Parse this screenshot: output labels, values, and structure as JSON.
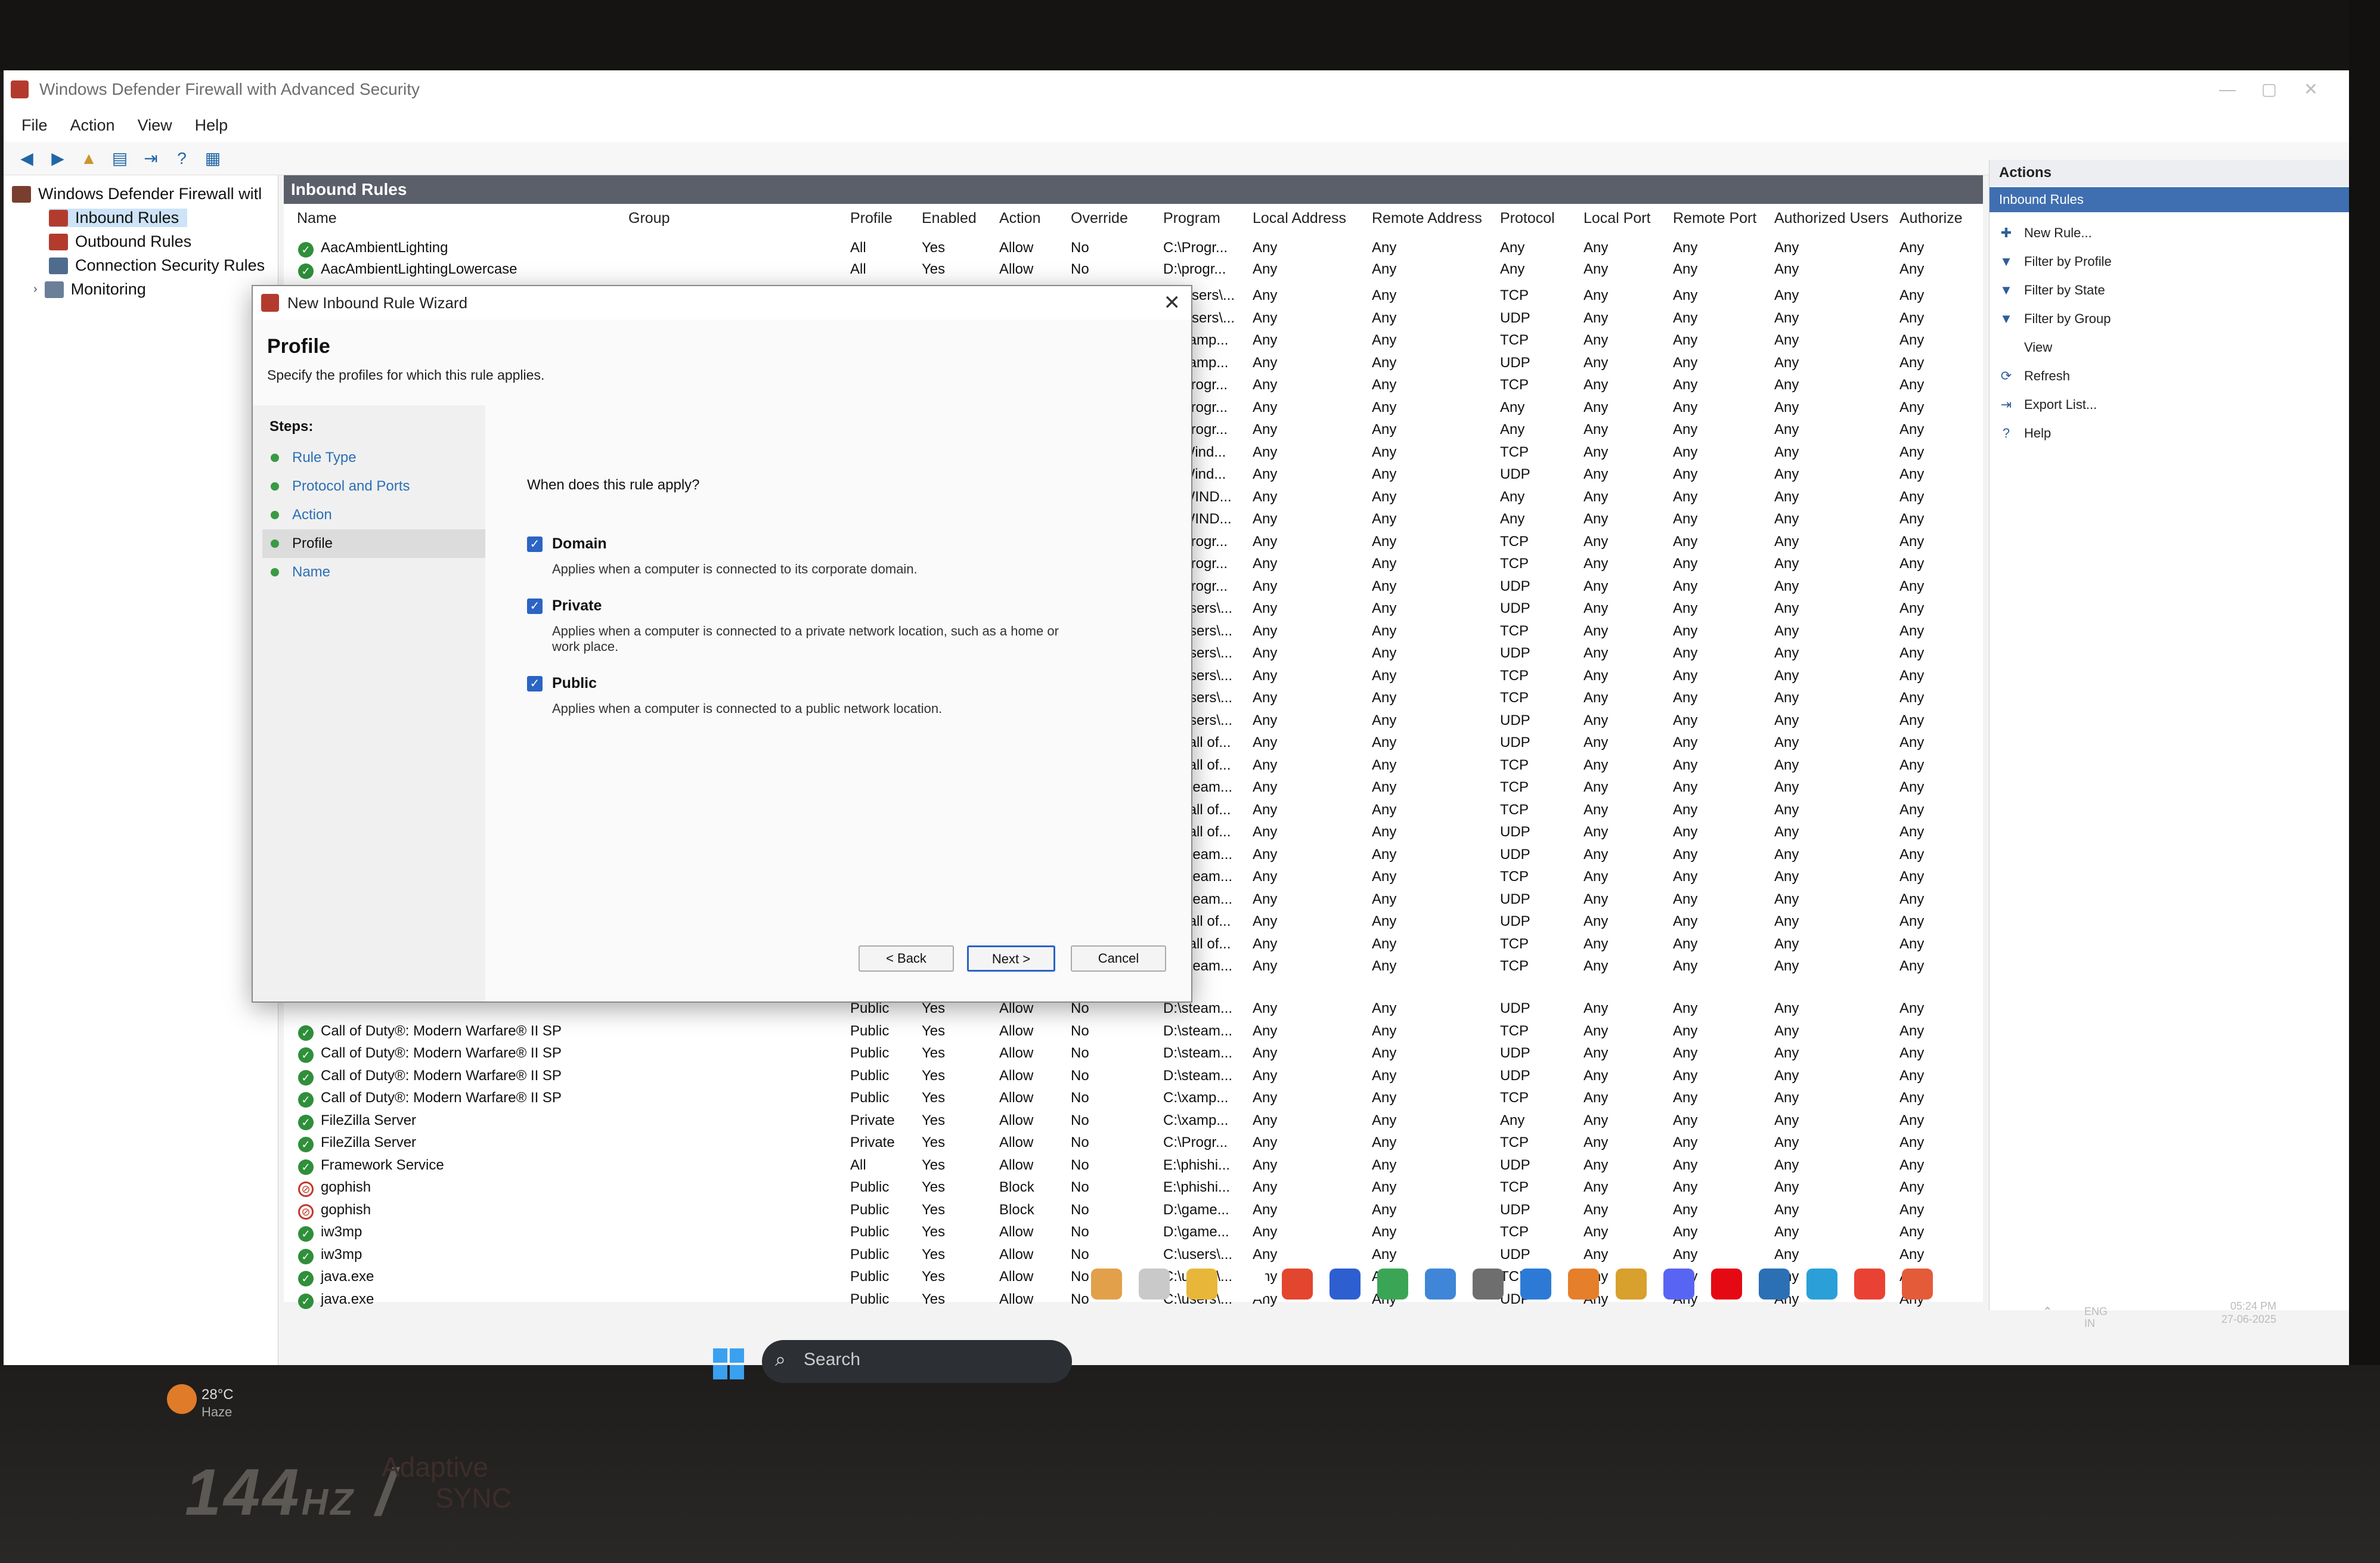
{
  "window": {
    "title": "Windows Defender Firewall with Advanced Security",
    "menu": [
      "File",
      "Action",
      "View",
      "Help"
    ]
  },
  "tree": {
    "root": "Windows Defender Firewall witl",
    "items": [
      "Inbound Rules",
      "Outbound Rules",
      "Connection Security Rules",
      "Monitoring"
    ]
  },
  "list": {
    "header": "Inbound Rules",
    "columns": [
      "Name",
      "Group",
      "Profile",
      "Enabled",
      "Action",
      "Override",
      "Program",
      "Local Address",
      "Remote Address",
      "Protocol",
      "Local Port",
      "Remote Port",
      "Authorized Users",
      "Authorize"
    ],
    "top_rows": [
      {
        "name": "AacAmbientLighting",
        "profile": "All",
        "enabled": "Yes",
        "action": "Allow",
        "override": "No",
        "program": "C:\\Progr...",
        "local": "Any",
        "remote": "Any",
        "protocol": "Any",
        "lport": "Any",
        "rport": "Any",
        "users": "Any",
        "auth": "Any"
      },
      {
        "name": "AacAmbientLightingLowercase",
        "profile": "All",
        "enabled": "Yes",
        "action": "Allow",
        "override": "No",
        "program": "D:\\progr...",
        "local": "Any",
        "remote": "Any",
        "protocol": "Any",
        "lport": "Any",
        "rport": "Any",
        "users": "Any",
        "auth": "Any"
      }
    ],
    "side_rows": [
      {
        "program": "C:\\Users\\...",
        "local": "Any",
        "remote": "Any",
        "protocol": "TCP",
        "lport": "Any",
        "rport": "Any",
        "users": "Any",
        "auth": "Any"
      },
      {
        "program": "C:\\Users\\...",
        "local": "Any",
        "remote": "Any",
        "protocol": "UDP",
        "lport": "Any",
        "rport": "Any",
        "users": "Any",
        "auth": "Any"
      },
      {
        "program": "C:\\xamp...",
        "local": "Any",
        "remote": "Any",
        "protocol": "TCP",
        "lport": "Any",
        "rport": "Any",
        "users": "Any",
        "auth": "Any"
      },
      {
        "program": "C:\\xamp...",
        "local": "Any",
        "remote": "Any",
        "protocol": "UDP",
        "lport": "Any",
        "rport": "Any",
        "users": "Any",
        "auth": "Any"
      },
      {
        "program": "C:\\Progr...",
        "local": "Any",
        "remote": "Any",
        "protocol": "TCP",
        "lport": "Any",
        "rport": "Any",
        "users": "Any",
        "auth": "Any"
      },
      {
        "program": "C:\\Progr...",
        "local": "Any",
        "remote": "Any",
        "protocol": "Any",
        "lport": "Any",
        "rport": "Any",
        "users": "Any",
        "auth": "Any"
      },
      {
        "program": "C:\\Progr...",
        "local": "Any",
        "remote": "Any",
        "protocol": "Any",
        "lport": "Any",
        "rport": "Any",
        "users": "Any",
        "auth": "Any"
      },
      {
        "program": "C:\\Wind...",
        "local": "Any",
        "remote": "Any",
        "protocol": "TCP",
        "lport": "Any",
        "rport": "Any",
        "users": "Any",
        "auth": "Any"
      },
      {
        "program": "C:\\Wind...",
        "local": "Any",
        "remote": "Any",
        "protocol": "UDP",
        "lport": "Any",
        "rport": "Any",
        "users": "Any",
        "auth": "Any"
      },
      {
        "program": "C:\\WIND...",
        "local": "Any",
        "remote": "Any",
        "protocol": "Any",
        "lport": "Any",
        "rport": "Any",
        "users": "Any",
        "auth": "Any"
      },
      {
        "program": "C:\\WIND...",
        "local": "Any",
        "remote": "Any",
        "protocol": "Any",
        "lport": "Any",
        "rport": "Any",
        "users": "Any",
        "auth": "Any"
      },
      {
        "program": "C:\\Progr...",
        "local": "Any",
        "remote": "Any",
        "protocol": "TCP",
        "lport": "Any",
        "rport": "Any",
        "users": "Any",
        "auth": "Any"
      },
      {
        "program": "C:\\Progr...",
        "local": "Any",
        "remote": "Any",
        "protocol": "TCP",
        "lport": "Any",
        "rport": "Any",
        "users": "Any",
        "auth": "Any"
      },
      {
        "program": "C:\\Progr...",
        "local": "Any",
        "remote": "Any",
        "protocol": "UDP",
        "lport": "Any",
        "rport": "Any",
        "users": "Any",
        "auth": "Any"
      },
      {
        "program": "C:\\users\\...",
        "local": "Any",
        "remote": "Any",
        "protocol": "UDP",
        "lport": "Any",
        "rport": "Any",
        "users": "Any",
        "auth": "Any"
      },
      {
        "program": "C:\\users\\...",
        "local": "Any",
        "remote": "Any",
        "protocol": "TCP",
        "lport": "Any",
        "rport": "Any",
        "users": "Any",
        "auth": "Any"
      },
      {
        "program": "C:\\users\\...",
        "local": "Any",
        "remote": "Any",
        "protocol": "UDP",
        "lport": "Any",
        "rport": "Any",
        "users": "Any",
        "auth": "Any"
      },
      {
        "program": "C:\\users\\...",
        "local": "Any",
        "remote": "Any",
        "protocol": "TCP",
        "lport": "Any",
        "rport": "Any",
        "users": "Any",
        "auth": "Any"
      },
      {
        "program": "C:\\users\\...",
        "local": "Any",
        "remote": "Any",
        "protocol": "TCP",
        "lport": "Any",
        "rport": "Any",
        "users": "Any",
        "auth": "Any"
      },
      {
        "program": "C:\\users\\...",
        "local": "Any",
        "remote": "Any",
        "protocol": "UDP",
        "lport": "Any",
        "rport": "Any",
        "users": "Any",
        "auth": "Any"
      },
      {
        "program": "D:\\call of...",
        "local": "Any",
        "remote": "Any",
        "protocol": "UDP",
        "lport": "Any",
        "rport": "Any",
        "users": "Any",
        "auth": "Any"
      },
      {
        "program": "D:\\call of...",
        "local": "Any",
        "remote": "Any",
        "protocol": "TCP",
        "lport": "Any",
        "rport": "Any",
        "users": "Any",
        "auth": "Any"
      },
      {
        "program": "D:\\steam...",
        "local": "Any",
        "remote": "Any",
        "protocol": "TCP",
        "lport": "Any",
        "rport": "Any",
        "users": "Any",
        "auth": "Any"
      },
      {
        "program": "D:\\call of...",
        "local": "Any",
        "remote": "Any",
        "protocol": "TCP",
        "lport": "Any",
        "rport": "Any",
        "users": "Any",
        "auth": "Any"
      },
      {
        "program": "D:\\call of...",
        "local": "Any",
        "remote": "Any",
        "protocol": "UDP",
        "lport": "Any",
        "rport": "Any",
        "users": "Any",
        "auth": "Any"
      },
      {
        "program": "D:\\steam...",
        "local": "Any",
        "remote": "Any",
        "protocol": "UDP",
        "lport": "Any",
        "rport": "Any",
        "users": "Any",
        "auth": "Any"
      },
      {
        "program": "D:\\steam...",
        "local": "Any",
        "remote": "Any",
        "protocol": "TCP",
        "lport": "Any",
        "rport": "Any",
        "users": "Any",
        "auth": "Any"
      },
      {
        "program": "D:\\steam...",
        "local": "Any",
        "remote": "Any",
        "protocol": "UDP",
        "lport": "Any",
        "rport": "Any",
        "users": "Any",
        "auth": "Any"
      },
      {
        "program": "D:\\call of...",
        "local": "Any",
        "remote": "Any",
        "protocol": "UDP",
        "lport": "Any",
        "rport": "Any",
        "users": "Any",
        "auth": "Any"
      },
      {
        "program": "D:\\call of...",
        "local": "Any",
        "remote": "Any",
        "protocol": "TCP",
        "lport": "Any",
        "rport": "Any",
        "users": "Any",
        "auth": "Any"
      },
      {
        "program": "D:\\steam...",
        "local": "Any",
        "remote": "Any",
        "protocol": "TCP",
        "lport": "Any",
        "rport": "Any",
        "users": "Any",
        "auth": "Any"
      }
    ],
    "bottom_rows": [
      {
        "icon": "allow",
        "name": "",
        "profile": "Public",
        "enabled": "Yes",
        "action": "Allow",
        "override": "No",
        "program": "D:\\steam...",
        "local": "Any",
        "remote": "Any",
        "protocol": "UDP",
        "lport": "Any",
        "rport": "Any",
        "users": "Any",
        "auth": "Any"
      },
      {
        "icon": "allow",
        "name": "Call of Duty®: Modern Warfare® II SP",
        "profile": "Public",
        "enabled": "Yes",
        "action": "Allow",
        "override": "No",
        "program": "D:\\steam...",
        "local": "Any",
        "remote": "Any",
        "protocol": "TCP",
        "lport": "Any",
        "rport": "Any",
        "users": "Any",
        "auth": "Any"
      },
      {
        "icon": "allow",
        "name": "Call of Duty®: Modern Warfare® II SP",
        "profile": "Public",
        "enabled": "Yes",
        "action": "Allow",
        "override": "No",
        "program": "D:\\steam...",
        "local": "Any",
        "remote": "Any",
        "protocol": "UDP",
        "lport": "Any",
        "rport": "Any",
        "users": "Any",
        "auth": "Any"
      },
      {
        "icon": "allow",
        "name": "Call of Duty®: Modern Warfare® II SP",
        "profile": "Public",
        "enabled": "Yes",
        "action": "Allow",
        "override": "No",
        "program": "D:\\steam...",
        "local": "Any",
        "remote": "Any",
        "protocol": "UDP",
        "lport": "Any",
        "rport": "Any",
        "users": "Any",
        "auth": "Any"
      },
      {
        "icon": "allow",
        "name": "Call of Duty®: Modern Warfare® II SP",
        "profile": "Public",
        "enabled": "Yes",
        "action": "Allow",
        "override": "No",
        "program": "C:\\xamp...",
        "local": "Any",
        "remote": "Any",
        "protocol": "TCP",
        "lport": "Any",
        "rport": "Any",
        "users": "Any",
        "auth": "Any"
      },
      {
        "icon": "allow",
        "name": "FileZilla Server",
        "profile": "Private",
        "enabled": "Yes",
        "action": "Allow",
        "override": "No",
        "program": "C:\\xamp...",
        "local": "Any",
        "remote": "Any",
        "protocol": "Any",
        "lport": "Any",
        "rport": "Any",
        "users": "Any",
        "auth": "Any"
      },
      {
        "icon": "allow",
        "name": "FileZilla Server",
        "profile": "Private",
        "enabled": "Yes",
        "action": "Allow",
        "override": "No",
        "program": "C:\\Progr...",
        "local": "Any",
        "remote": "Any",
        "protocol": "TCP",
        "lport": "Any",
        "rport": "Any",
        "users": "Any",
        "auth": "Any"
      },
      {
        "icon": "allow",
        "name": "Framework Service",
        "profile": "All",
        "enabled": "Yes",
        "action": "Allow",
        "override": "No",
        "program": "E:\\phishi...",
        "local": "Any",
        "remote": "Any",
        "protocol": "UDP",
        "lport": "Any",
        "rport": "Any",
        "users": "Any",
        "auth": "Any"
      },
      {
        "icon": "block",
        "name": "gophish",
        "profile": "Public",
        "enabled": "Yes",
        "action": "Block",
        "override": "No",
        "program": "E:\\phishi...",
        "local": "Any",
        "remote": "Any",
        "protocol": "TCP",
        "lport": "Any",
        "rport": "Any",
        "users": "Any",
        "auth": "Any"
      },
      {
        "icon": "block",
        "name": "gophish",
        "profile": "Public",
        "enabled": "Yes",
        "action": "Block",
        "override": "No",
        "program": "D:\\game...",
        "local": "Any",
        "remote": "Any",
        "protocol": "UDP",
        "lport": "Any",
        "rport": "Any",
        "users": "Any",
        "auth": "Any"
      },
      {
        "icon": "allow",
        "name": "iw3mp",
        "profile": "Public",
        "enabled": "Yes",
        "action": "Allow",
        "override": "No",
        "program": "D:\\game...",
        "local": "Any",
        "remote": "Any",
        "protocol": "TCP",
        "lport": "Any",
        "rport": "Any",
        "users": "Any",
        "auth": "Any"
      },
      {
        "icon": "allow",
        "name": "iw3mp",
        "profile": "Public",
        "enabled": "Yes",
        "action": "Allow",
        "override": "No",
        "program": "C:\\users\\...",
        "local": "Any",
        "remote": "Any",
        "protocol": "UDP",
        "lport": "Any",
        "rport": "Any",
        "users": "Any",
        "auth": "Any"
      },
      {
        "icon": "allow",
        "name": "java.exe",
        "profile": "Public",
        "enabled": "Yes",
        "action": "Allow",
        "override": "No",
        "program": "C:\\users\\...",
        "local": "Any",
        "remote": "Any",
        "protocol": "TCP",
        "lport": "Any",
        "rport": "Any",
        "users": "Any",
        "auth": "Any"
      },
      {
        "icon": "allow",
        "name": "java.exe",
        "profile": "Public",
        "enabled": "Yes",
        "action": "Allow",
        "override": "No",
        "program": "C:\\users\\...",
        "local": "Any",
        "remote": "Any",
        "protocol": "UDP",
        "lport": "Any",
        "rport": "Any",
        "users": "Any",
        "auth": "Any"
      }
    ]
  },
  "actions": {
    "title": "Actions",
    "section": "Inbound Rules",
    "items": [
      "New Rule...",
      "Filter by Profile",
      "Filter by State",
      "Filter by Group",
      "View",
      "Refresh",
      "Export List...",
      "Help"
    ]
  },
  "dialog": {
    "title": "New Inbound Rule Wizard",
    "heading": "Profile",
    "subheading": "Specify the profiles for which this rule applies.",
    "steps_label": "Steps:",
    "steps": [
      "Rule Type",
      "Protocol and Ports",
      "Action",
      "Profile",
      "Name"
    ],
    "active_step": "Profile",
    "question": "When does this rule apply?",
    "options": [
      {
        "name": "Domain",
        "checked": true,
        "desc": "Applies when a computer is connected to its corporate domain."
      },
      {
        "name": "Private",
        "checked": true,
        "desc": "Applies when a computer is connected to a private network location, such as a home or work place."
      },
      {
        "name": "Public",
        "checked": true,
        "desc": "Applies when a computer is connected to a public network location."
      }
    ],
    "back_label": "< Back",
    "next_label": "Next >",
    "cancel_label": "Cancel"
  },
  "taskbar": {
    "search_placeholder": "Search",
    "weather_temp": "28°C",
    "weather_cond": "Haze",
    "lang": "ENG",
    "lang_region": "IN",
    "time": "05:24 PM",
    "date": "27-06-2025"
  },
  "chassis": {
    "refresh_rate": "144",
    "refresh_unit": "HZ",
    "sync_line1": "Adaptive",
    "sync_line2": "SYNC"
  },
  "colors": {
    "allow_icon": "#2f8f3a",
    "block_icon": "#c0392b",
    "accent": "#2b64c4",
    "header_bg": "#5a5f6a"
  }
}
